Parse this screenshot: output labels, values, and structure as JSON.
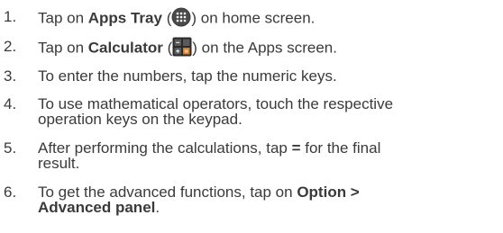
{
  "steps": [
    {
      "number": "1.",
      "pre": "Tap on ",
      "bold": "Apps Tray",
      "open": " (",
      "icon": "apps-tray-icon",
      "close": ") on home screen."
    },
    {
      "number": "2.",
      "pre": "Tap on ",
      "bold": "Calculator",
      "open": " (",
      "icon": "calculator-icon",
      "close": ") on the Apps screen."
    },
    {
      "number": "3.",
      "text": "To enter the numbers, tap the numeric keys."
    },
    {
      "number": "4.",
      "line1": "To use mathematical operators, touch the respective",
      "line2": "operation keys on the keypad."
    },
    {
      "number": "5.",
      "line1_pre": "After performing the calculations, tap ",
      "line1_bold": "=",
      "line1_post": " for the final",
      "line2": "result."
    },
    {
      "number": "6.",
      "line1_pre": "To get the advanced functions, tap on ",
      "line1_bold": "Option >",
      "line2_bold": "Advanced panel",
      "line2_post": "."
    }
  ],
  "colors": {
    "text": "#3a3a3a",
    "apps_icon_bg": "#3b3b3b",
    "calc_icon_bg": "#2a2a2a"
  }
}
